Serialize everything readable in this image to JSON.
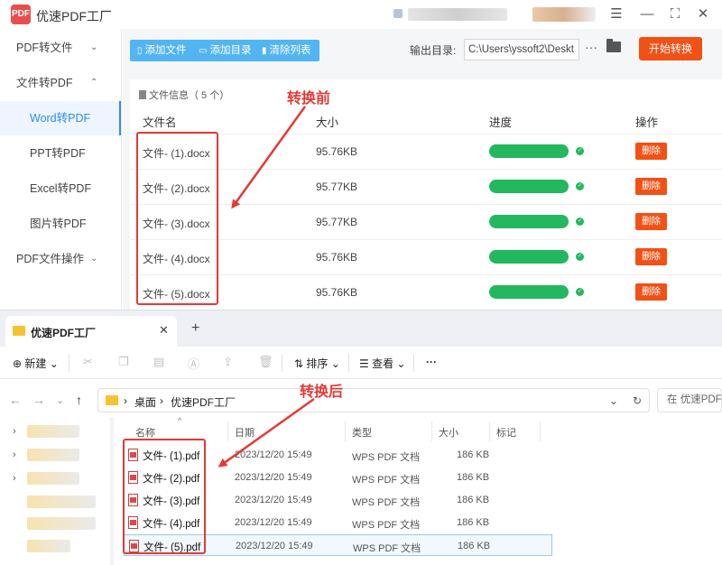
{
  "app": {
    "title": "优速PDF工厂",
    "logo_text": "PDF",
    "window_controls": [
      "☰",
      "—",
      "⛶",
      "✕"
    ]
  },
  "sidebar": {
    "items": [
      {
        "label": "PDF转文件",
        "chevron": "⌄"
      },
      {
        "label": "文件转PDF",
        "chevron": "⌃"
      },
      {
        "label": "Word转PDF"
      },
      {
        "label": "PPT转PDF"
      },
      {
        "label": "Excel转PDF"
      },
      {
        "label": "图片转PDF"
      },
      {
        "label": "PDF文件操作",
        "chevron": "⌄"
      }
    ]
  },
  "toolbar": {
    "add_file": "添加文件",
    "add_dir": "添加目录",
    "clear_list": "清除列表",
    "output_label": "输出目录:",
    "output_path": "C:\\Users\\yssoft2\\Deskt",
    "more": "···",
    "start": "开始转换"
  },
  "file_list": {
    "info": "文件信息（ 5 个）",
    "headers": {
      "name": "文件名",
      "size": "大小",
      "progress": "进度",
      "action": "操作"
    },
    "rows": [
      {
        "name": "文件- (1).docx",
        "size": "95.76KB",
        "progress": 1.0,
        "action": "删除"
      },
      {
        "name": "文件- (2).docx",
        "size": "95.77KB",
        "progress": 1.0,
        "action": "删除"
      },
      {
        "name": "文件- (3).docx",
        "size": "95.77KB",
        "progress": 1.0,
        "action": "删除"
      },
      {
        "name": "文件- (4).docx",
        "size": "95.76KB",
        "progress": 1.0,
        "action": "删除"
      },
      {
        "name": "文件- (5).docx",
        "size": "95.76KB",
        "progress": 1.0,
        "action": "删除"
      }
    ]
  },
  "explorer": {
    "tab_title": "优速PDF工厂",
    "tab_close": "✕",
    "tab_add": "+",
    "commands": {
      "new": "新建",
      "sort": "排序",
      "view": "查看",
      "more": "···"
    },
    "breadcrumb": [
      "桌面",
      "优速PDF工厂"
    ],
    "search_placeholder": "在 优速PDF工厂",
    "headers": {
      "name": "名称",
      "date": "日期",
      "type": "类型",
      "size": "大小",
      "tag": "标记"
    },
    "files": [
      {
        "name": "文件- (1).pdf",
        "date": "2023/12/20 15:49",
        "type": "WPS PDF 文档",
        "size": "186 KB"
      },
      {
        "name": "文件- (2).pdf",
        "date": "2023/12/20 15:49",
        "type": "WPS PDF 文档",
        "size": "186 KB"
      },
      {
        "name": "文件- (3).pdf",
        "date": "2023/12/20 15:49",
        "type": "WPS PDF 文档",
        "size": "186 KB"
      },
      {
        "name": "文件- (4).pdf",
        "date": "2023/12/20 15:49",
        "type": "WPS PDF 文档",
        "size": "186 KB"
      },
      {
        "name": "文件- (5).pdf",
        "date": "2023/12/20 15:49",
        "type": "WPS PDF 文档",
        "size": "186 KB"
      }
    ]
  },
  "annotations": {
    "before": "转换前",
    "after": "转换后"
  },
  "colors": {
    "accent": "#2d8cf0",
    "toolbar_blue": "#52b5f2",
    "orange": "#f25116",
    "progress_green": "#23b85e",
    "annotation_red": "#e53935"
  }
}
